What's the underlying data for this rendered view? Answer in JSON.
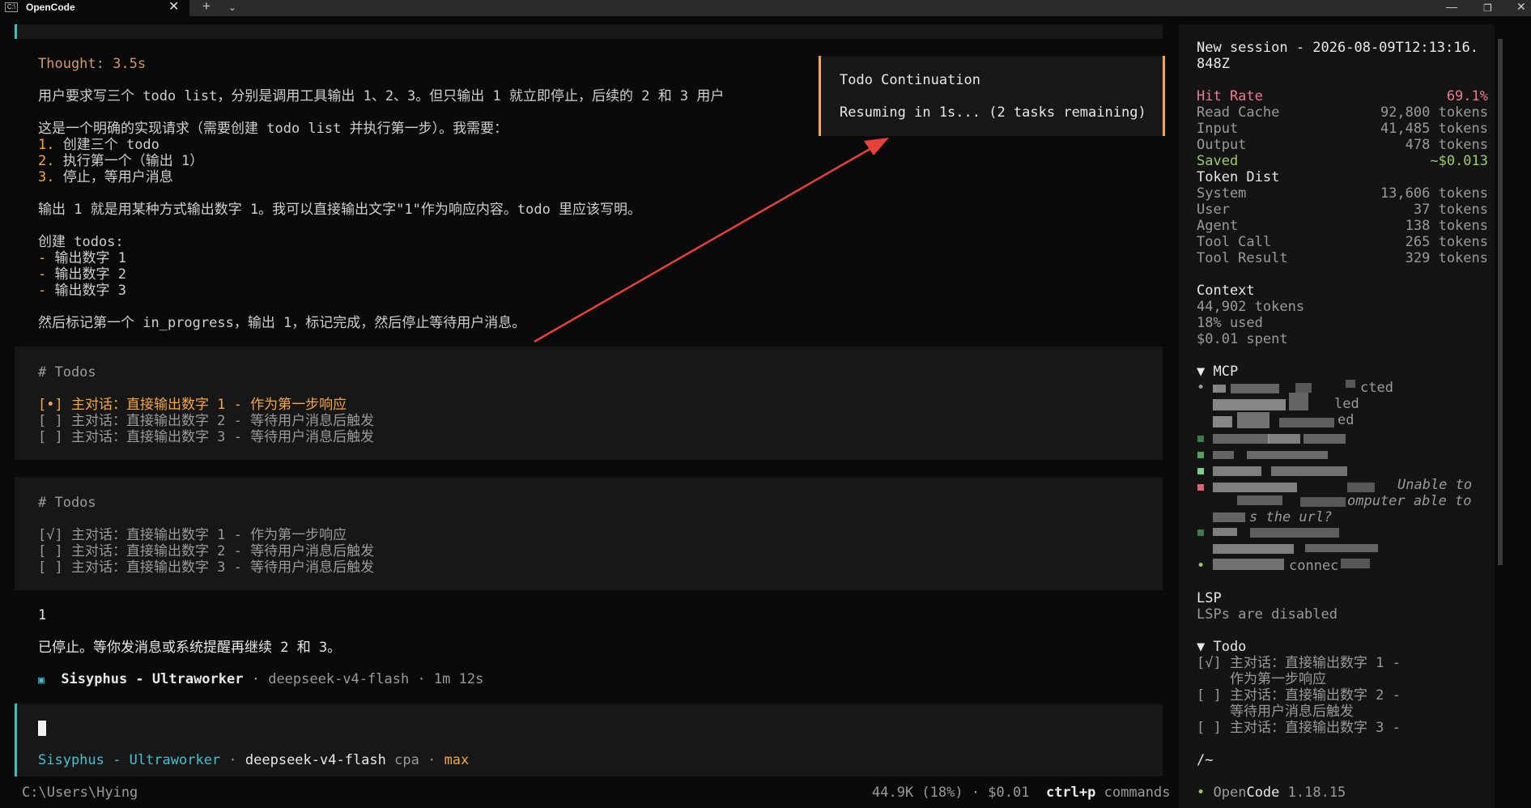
{
  "window": {
    "title": "OpenCode",
    "close": "✕",
    "new_tab": "+",
    "dropdown": "⌄",
    "minimize": "—",
    "maximize": "❐",
    "close_window": "✕"
  },
  "chat": {
    "thought_label": "Thought: 3.5s",
    "thought_lines": [
      "用户要求写三个 todo list，分别是调用工具输出 1、2、3。但只输出 1 就立即停止，后续的 2 和 3 用户",
      "",
      "这是一个明确的实现请求（需要创建 todo list 并执行第一步）。我需要：",
      "",
      "",
      "",
      "",
      "输出 1 就是用某种方式输出数字 1。我可以直接输出文字\"1\"作为响应内容。todo 里应该写明。",
      "",
      "创建 todos:",
      "",
      "",
      "",
      "",
      "然后标记第一个 in_progress，输出 1，标记完成，然后停止等待用户消息。"
    ],
    "steps": [
      {
        "num": "1.",
        "text": " 创建三个 todo"
      },
      {
        "num": "2.",
        "text": " 执行第一个（输出 1）"
      },
      {
        "num": "3.",
        "text": " 停止，等用户消息"
      }
    ],
    "todo_bullets": [
      {
        "dash": "-",
        "text": " 输出数字 1"
      },
      {
        "dash": "-",
        "text": " 输出数字 2"
      },
      {
        "dash": "-",
        "text": " 输出数字 3"
      }
    ],
    "todos_block_1": {
      "heading": "# Todos",
      "items": [
        {
          "text": "[•] 主对话：直接输出数字 1 - 作为第一步响应"
        },
        {
          "text": "[ ] 主对话：直接输出数字 2 - 等待用户消息后触发"
        },
        {
          "text": "[ ] 主对话：直接输出数字 3 - 等待用户消息后触发"
        }
      ]
    },
    "todos_block_2": {
      "heading": "# Todos",
      "items": [
        {
          "text": "[√] 主对话：直接输出数字 1 - 作为第一步响应"
        },
        {
          "text": "[ ] 主对话：直接输出数字 2 - 等待用户消息后触发"
        },
        {
          "text": "[ ] 主对话：直接输出数字 3 - 等待用户消息后触发"
        }
      ]
    },
    "output_value": "1",
    "stopped_message": "已停止。等你发消息或系统提醒再继续 2 和 3。",
    "meta": {
      "icon": "▣",
      "agent": "Sisyphus - Ultraworker",
      "sep1": " · ",
      "model": "deepseek-v4-flash",
      "sep2": " · ",
      "duration": "1m 12s"
    }
  },
  "toast": {
    "title": "Todo Continuation",
    "message": "Resuming in 1s... (2 tasks remaining)"
  },
  "prompt": {
    "agent": "Sisyphus - Ultraworker",
    "sep1": " · ",
    "model": "deepseek-v4-flash",
    "provider": " cpa",
    "sep2": " · ",
    "variant": "max"
  },
  "statusbar": {
    "cwd": "C:\\Users\\Hying",
    "usage": "44.9K (18%) · $0.01",
    "shortcut": "ctrl+p",
    "shortcut_label": " commands"
  },
  "sidebar": {
    "session_title_1": "New session - 2026-08-09T12:13:16.",
    "session_title_2": "848Z",
    "stats": [
      {
        "label": "Hit Rate",
        "value": "69.1%",
        "style": "pink"
      },
      {
        "label": "Read Cache",
        "value": "92,800 tokens",
        "style": "dim"
      },
      {
        "label": "Input",
        "value": "41,485 tokens",
        "style": "dim"
      },
      {
        "label": "Output",
        "value": "478 tokens",
        "style": "dim"
      },
      {
        "label": "Saved",
        "value": "~$0.013",
        "style": "green"
      }
    ],
    "token_dist_title": "Token Dist",
    "token_dist": [
      {
        "label": "System",
        "value": "13,606 tokens"
      },
      {
        "label": "User",
        "value": "37 tokens"
      },
      {
        "label": "Agent",
        "value": "138 tokens"
      },
      {
        "label": "Tool Call",
        "value": "265 tokens"
      },
      {
        "label": "Tool Result",
        "value": "329 tokens"
      }
    ],
    "context_title": "Context",
    "context_tokens": "44,902 tokens",
    "context_used": "18% used",
    "context_spent": "$0.01 spent",
    "mcp_title": "▼ MCP",
    "mcp_fragments": {
      "l1": "cted",
      "l2": "led",
      "l3": "ed",
      "err1": "Unable to",
      "err2": "omputer able to",
      "err3": "s the url?",
      "l4": "connec"
    },
    "lsp_title": "LSP",
    "lsp_status": "LSPs are disabled",
    "todo_title": "▼ Todo",
    "todo_lines": [
      "[√] 主对话：直接输出数字 1 -",
      "    作为第一步响应",
      "[ ] 主对话：直接输出数字 2 -",
      "    等待用户消息后触发",
      "[ ] 主对话：直接输出数字 3 -"
    ],
    "path": "/~",
    "app_dot": "•",
    "app_name_open": "Open",
    "app_name_code": "Code",
    "app_version": " 1.18.15"
  },
  "colors": {
    "accent_teal": "#2ec4c4",
    "accent_orange": "#f5a742",
    "annotation_arrow": "#e8403a"
  }
}
